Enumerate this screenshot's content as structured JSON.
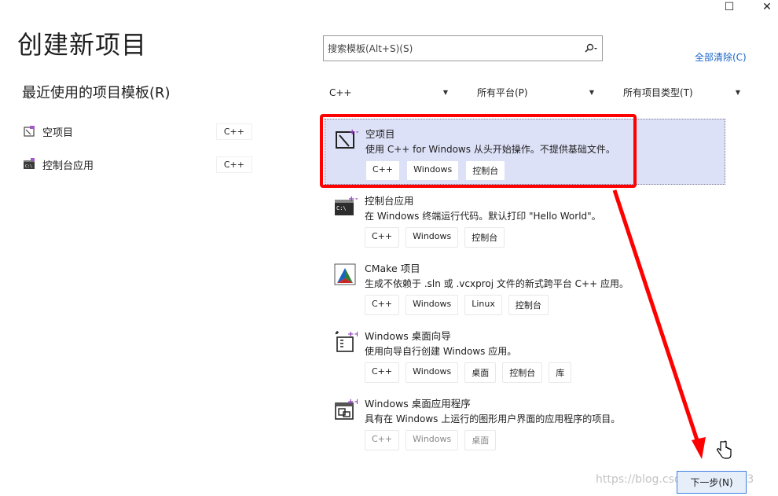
{
  "window": {
    "maximize_glyph": "☐",
    "close_glyph": "✕"
  },
  "page": {
    "title": "创建新项目",
    "recent_heading": "最近使用的项目模板(R)"
  },
  "recent": [
    {
      "label": "空项目",
      "tag": "C++",
      "icon": "empty-project-icon"
    },
    {
      "label": "控制台应用",
      "tag": "C++",
      "icon": "console-app-icon"
    }
  ],
  "search": {
    "placeholder": "搜索模板(Alt+S)(S)",
    "icon": "search-icon"
  },
  "clear_all": "全部清除(C)",
  "filters": {
    "language": "C++",
    "platform": "所有平台(P)",
    "project_type": "所有项目类型(T)"
  },
  "templates": [
    {
      "name": "空项目",
      "desc": "使用 C++ for Windows 从头开始操作。不提供基础文件。",
      "tags": [
        "C++",
        "Windows",
        "控制台"
      ]
    },
    {
      "name": "控制台应用",
      "desc": "在 Windows 终端运行代码。默认打印 \"Hello World\"。",
      "tags": [
        "C++",
        "Windows",
        "控制台"
      ]
    },
    {
      "name": "CMake 项目",
      "desc": "生成不依赖于 .sln 或 .vcxproj 文件的新式跨平台 C++ 应用。",
      "tags": [
        "C++",
        "Windows",
        "Linux",
        "控制台"
      ]
    },
    {
      "name": "Windows 桌面向导",
      "desc": "使用向导自行创建 Windows 应用。",
      "tags": [
        "C++",
        "Windows",
        "桌面",
        "控制台",
        "库"
      ]
    },
    {
      "name": "Windows 桌面应用程序",
      "desc": "具有在 Windows 上运行的图形用户界面的应用程序的项目。",
      "tags": [
        "C++",
        "Windows",
        "桌面"
      ]
    }
  ],
  "next_button": "下一步(N)",
  "watermark": "https://blog.csdn.net/zhe163",
  "colors": {
    "accent": "#1a66c9",
    "highlight": "#dde1f7",
    "annotation": "#ff0000",
    "next_border": "#3f7de0"
  }
}
